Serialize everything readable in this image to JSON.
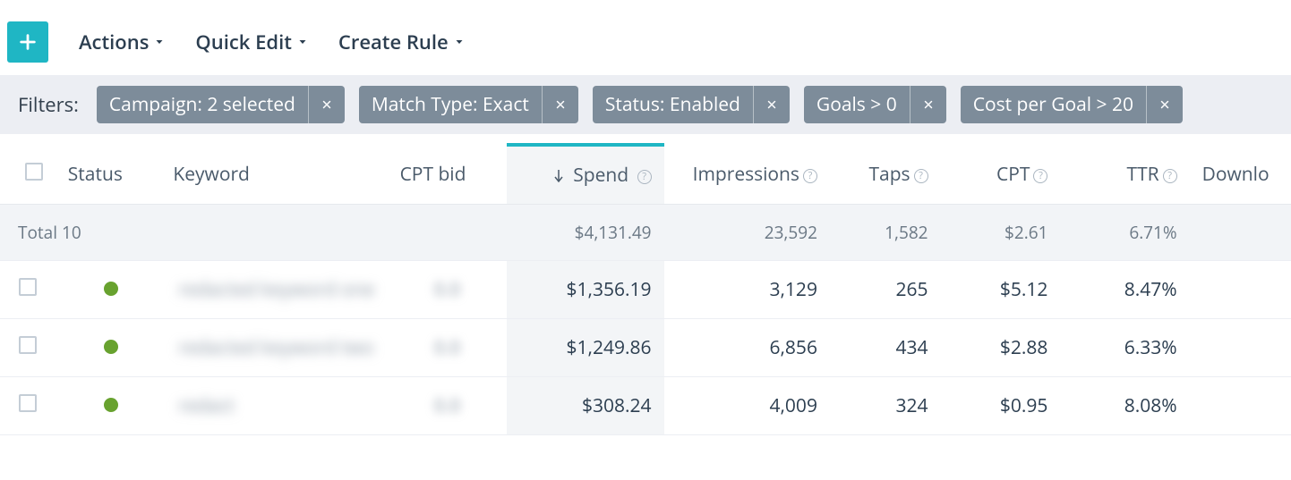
{
  "toolbar": {
    "actions_label": "Actions",
    "quick_edit_label": "Quick Edit",
    "create_rule_label": "Create Rule"
  },
  "filters": {
    "label": "Filters:",
    "items": [
      {
        "label": "Campaign: 2 selected"
      },
      {
        "label": "Match Type: Exact"
      },
      {
        "label": "Status: Enabled"
      },
      {
        "label": "Goals > 0"
      },
      {
        "label": "Cost per Goal > 20"
      }
    ]
  },
  "columns": {
    "status": "Status",
    "keyword": "Keyword",
    "cpt_bid": "CPT bid",
    "spend": "Spend",
    "impressions": "Impressions",
    "taps": "Taps",
    "cpt": "CPT",
    "ttr": "TTR",
    "downloads": "Downlo"
  },
  "totals": {
    "label": "Total 10",
    "spend": "$4,131.49",
    "impressions": "23,592",
    "taps": "1,582",
    "cpt": "$2.61",
    "ttr": "6.71%"
  },
  "rows": [
    {
      "status": "enabled",
      "keyword": "redacted keyword one",
      "cpt_bid": "0.0",
      "spend": "$1,356.19",
      "impressions": "3,129",
      "taps": "265",
      "cpt": "$5.12",
      "ttr": "8.47%"
    },
    {
      "status": "enabled",
      "keyword": "redacted keyword two",
      "cpt_bid": "0.0",
      "spend": "$1,249.86",
      "impressions": "6,856",
      "taps": "434",
      "cpt": "$2.88",
      "ttr": "6.33%"
    },
    {
      "status": "enabled",
      "keyword": "redact",
      "cpt_bid": "0.0",
      "spend": "$308.24",
      "impressions": "4,009",
      "taps": "324",
      "cpt": "$0.95",
      "ttr": "8.08%"
    }
  ]
}
